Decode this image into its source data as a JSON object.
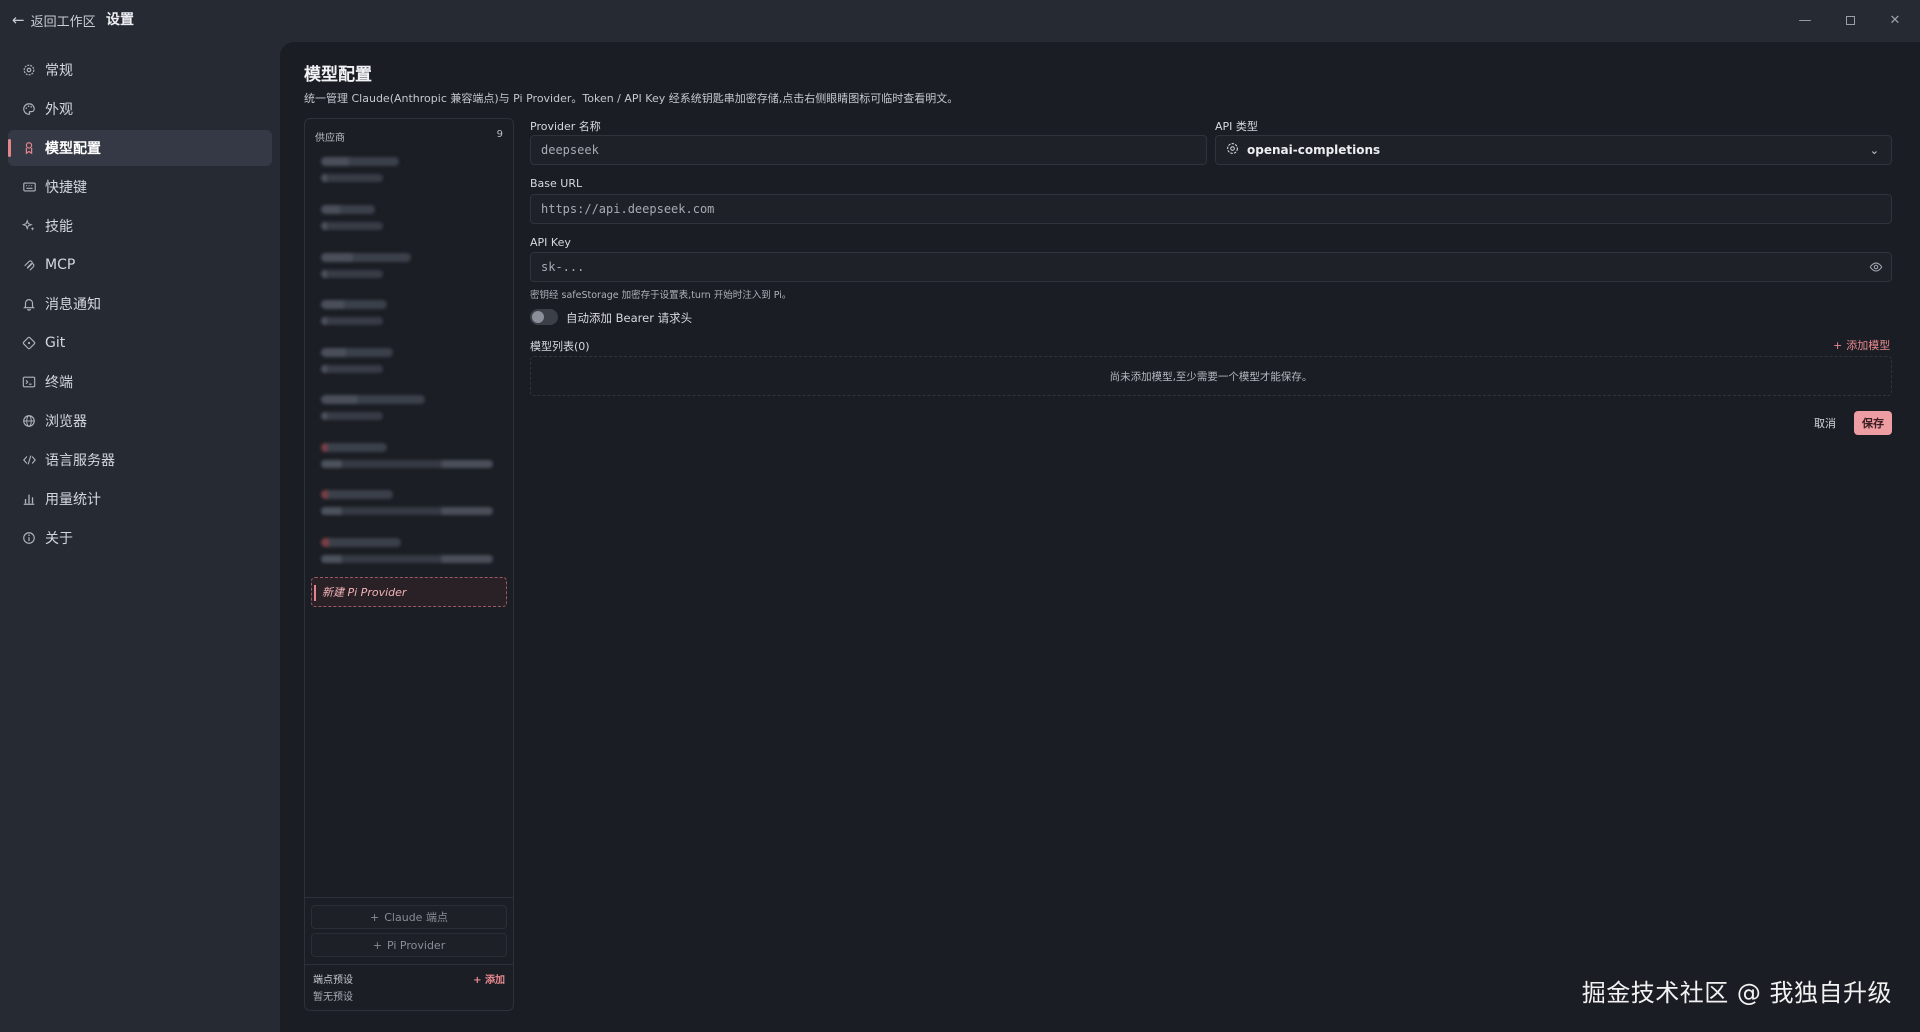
{
  "titlebar": {
    "back_label": "返回工作区",
    "title": "设置"
  },
  "nav": {
    "items": [
      {
        "label": "常规",
        "icon": "gear-icon"
      },
      {
        "label": "外观",
        "icon": "palette-icon"
      },
      {
        "label": "模型配置",
        "icon": "model-icon",
        "active": true
      },
      {
        "label": "快捷键",
        "icon": "keyboard-icon"
      },
      {
        "label": "技能",
        "icon": "sparkle-icon"
      },
      {
        "label": "MCP",
        "icon": "mcp-icon"
      },
      {
        "label": "消息通知",
        "icon": "bell-icon"
      },
      {
        "label": "Git",
        "icon": "git-icon"
      },
      {
        "label": "终端",
        "icon": "terminal-icon"
      },
      {
        "label": "浏览器",
        "icon": "globe-icon"
      },
      {
        "label": "语言服务器",
        "icon": "code-icon"
      },
      {
        "label": "用量统计",
        "icon": "bar-chart-icon"
      },
      {
        "label": "关于",
        "icon": "info-icon"
      }
    ]
  },
  "page": {
    "title": "模型配置",
    "description": "统一管理 Claude(Anthropic 兼容端点)与 Pi Provider。Token / API Key 经系统钥匙串加密存储,点击右侧眼睛图标可临时查看明文。"
  },
  "providers": {
    "header": "供应商",
    "count": "9",
    "new_item": "新建 Pi Provider",
    "add_claude": "Claude 端点",
    "add_pi": "Pi Provider",
    "preset_label": "端点预设",
    "preset_add": "+ 添加",
    "preset_empty": "暂无预设"
  },
  "form": {
    "provider_name_label": "Provider 名称",
    "provider_name_value": "deepseek",
    "api_type_label": "API 类型",
    "api_type_value": "openai-completions",
    "base_url_label": "Base URL",
    "base_url_value": "https://api.deepseek.com",
    "api_key_label": "API Key",
    "api_key_value": "sk-...",
    "api_key_hint": "密钥经 safeStorage 加密存于设置表,turn 开始时注入到 Pi。",
    "bearer_label": "自动添加 Bearer 请求头",
    "models_label": "模型列表(0)",
    "add_model": "添加模型",
    "models_empty": "尚未添加模型,至少需要一个模型才能保存。",
    "cancel": "取消",
    "save": "保存"
  },
  "watermark": "掘金技术社区 @ 我独自升级"
}
